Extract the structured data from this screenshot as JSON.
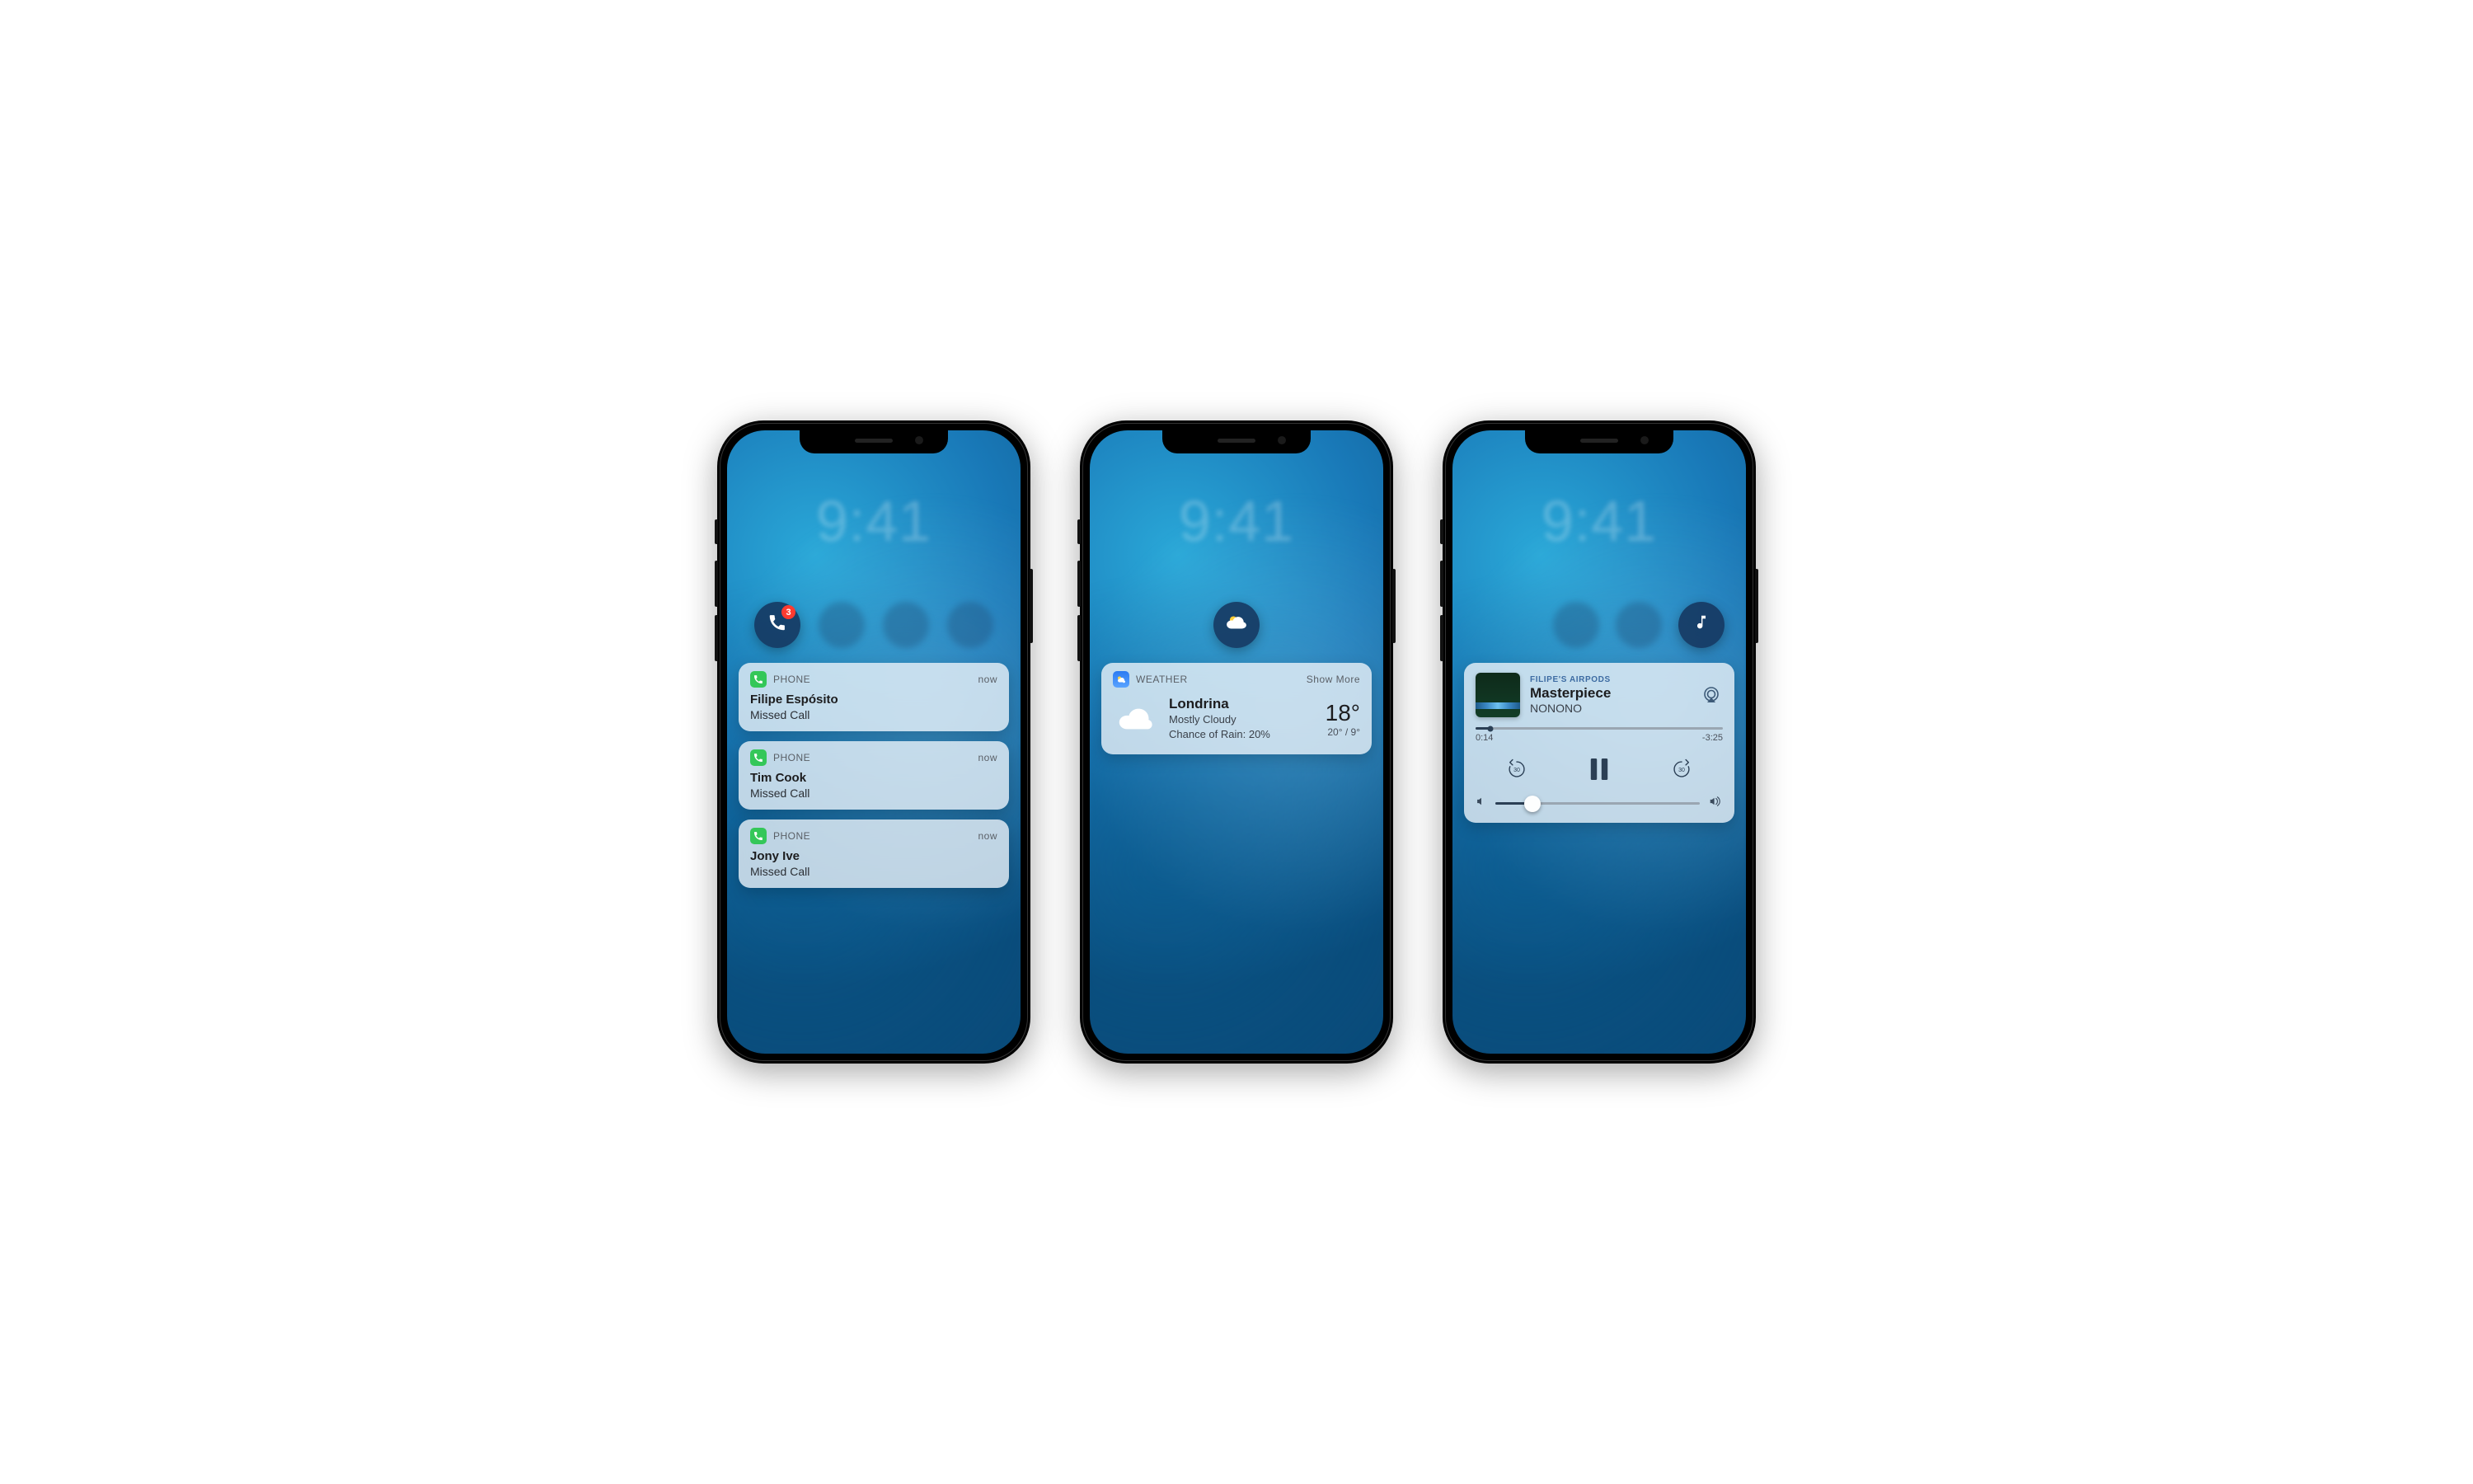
{
  "lock_clock": "9:41",
  "phone1": {
    "badge": "3",
    "cards": [
      {
        "app": "PHONE",
        "time": "now",
        "title": "Filipe Espósito",
        "sub": "Missed Call"
      },
      {
        "app": "PHONE",
        "time": "now",
        "title": "Tim Cook",
        "sub": "Missed Call"
      },
      {
        "app": "PHONE",
        "time": "now",
        "title": "Jony Ive",
        "sub": "Missed Call"
      }
    ]
  },
  "phone2": {
    "header_app": "WEATHER",
    "show_more": "Show More",
    "location": "Londrina",
    "condition": "Mostly Cloudy",
    "rain_label": "Chance of Rain: 20%",
    "temp": "18°",
    "hilo": "20° / 9°"
  },
  "phone3": {
    "source": "FILIPE'S AIRPODS",
    "track": "Masterpiece",
    "artist": "NONONO",
    "elapsed": "0:14",
    "remaining": "-3:25",
    "progress_pct": 6,
    "skip_seconds": "30",
    "volume_pct": 18
  }
}
